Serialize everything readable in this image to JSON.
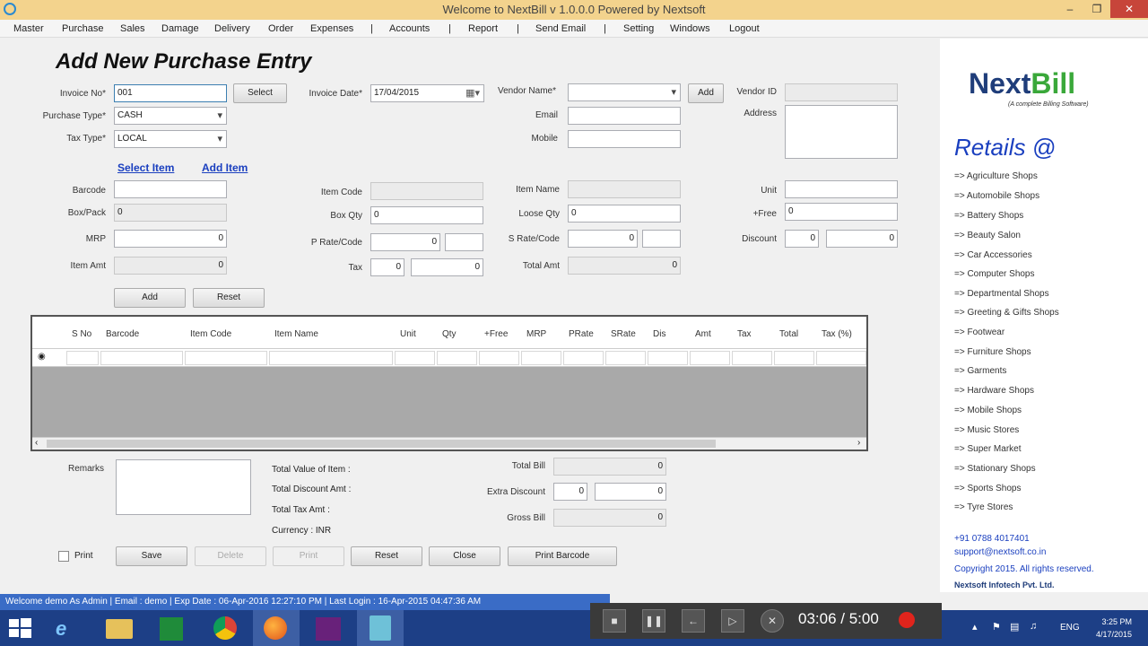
{
  "window": {
    "title": "Welcome to NextBill v 1.0.0.0 Powered by Nextsoft"
  },
  "menu": [
    "Master",
    "Purchase",
    "Sales",
    "Damage",
    "Delivery",
    "Order",
    "Expenses",
    "|",
    "Accounts",
    "|",
    "Report",
    "|",
    "Send Email",
    "|",
    "Setting",
    "Windows",
    "Logout"
  ],
  "page": {
    "title": "Add New Purchase Entry"
  },
  "form": {
    "invoice_no_label": "Invoice No*",
    "invoice_no": "001",
    "select_btn": "Select",
    "invoice_date_label": "Invoice Date*",
    "invoice_date": "17/04/2015",
    "vendor_name_label": "Vendor Name*",
    "add_btn": "Add",
    "vendor_id_label": "Vendor ID",
    "purchase_type_label": "Purchase Type*",
    "purchase_type": "CASH",
    "email_label": "Email",
    "address_label": "Address",
    "tax_type_label": "Tax Type*",
    "tax_type": "LOCAL",
    "mobile_label": "Mobile",
    "select_item_link": "Select Item",
    "add_item_link": "Add Item",
    "barcode_label": "Barcode",
    "item_code_label": "Item Code",
    "item_name_label": "Item Name",
    "unit_label": "Unit",
    "box_pack_label": "Box/Pack",
    "box_pack": "0",
    "box_qty_label": "Box Qty",
    "box_qty": "0",
    "loose_qty_label": "Loose Qty",
    "loose_qty": "0",
    "free_label": "+Free",
    "free": "0",
    "mrp_label": "MRP",
    "mrp": "0",
    "p_rate_label": "P Rate/Code",
    "p_rate": "0",
    "s_rate_label": "S Rate/Code",
    "s_rate": "0",
    "discount_label": "Discount",
    "discount_pct": "0",
    "discount_amt": "0",
    "item_amt_label": "Item Amt",
    "item_amt": "0",
    "tax_label": "Tax",
    "tax_pct": "0",
    "tax_amt": "0",
    "total_amt_label": "Total Amt",
    "total_amt": "0",
    "add_line_btn": "Add",
    "reset_line_btn": "Reset"
  },
  "grid": {
    "columns": [
      "S No",
      "Barcode",
      "Item Code",
      "Item Name",
      "Unit",
      "Qty",
      "+Free",
      "MRP",
      "PRate",
      "SRate",
      "Dis",
      "Amt",
      "Tax",
      "Total",
      "Tax (%)"
    ],
    "row_marker": "◉"
  },
  "footer": {
    "remarks_label": "Remarks",
    "total_value_label": "Total Value of Item :",
    "total_discount_label": "Total Discount Amt :",
    "total_tax_label": "Total Tax Amt :",
    "currency_label": "Currency : INR",
    "total_bill_label": "Total Bill",
    "total_bill": "0",
    "extra_discount_label": "Extra Discount",
    "extra_discount_pct": "0",
    "extra_discount_amt": "0",
    "gross_bill_label": "Gross Bill",
    "gross_bill": "0",
    "print_check_label": "Print",
    "save_btn": "Save",
    "delete_btn": "Delete",
    "print_btn": "Print",
    "reset_btn": "Reset",
    "close_btn": "Close",
    "print_barcode_btn": "Print Barcode"
  },
  "brand": {
    "logo_next": "Next",
    "logo_bill": "Bill",
    "tagline": "(A complete Billing Software)",
    "retails_title": "Retails @",
    "retails": [
      "=> Agriculture Shops",
      "=> Automobile Shops",
      "=> Battery Shops",
      "=> Beauty Salon",
      "=> Car Accessories",
      "=> Computer Shops",
      "=> Departmental Shops",
      "=> Greeting & Gifts Shops",
      "=> Footwear",
      "=> Furniture Shops",
      "=> Garments",
      "=> Hardware Shops",
      "=> Mobile Shops",
      "=> Music Stores",
      "=> Super Market",
      "=> Stationary Shops",
      "=> Sports Shops",
      "=> Tyre Stores"
    ],
    "phone": "+91 0788 4017401",
    "email": "support@nextsoft.co.in",
    "copyright": "Copyright 2015. All rights reserved.",
    "company": "Nextsoft Infotech Pvt. Ltd.",
    "colors": {
      "next": "#1f3d7a",
      "bill": "#3aa83a",
      "retails": "#1a3fbf"
    }
  },
  "status": {
    "text": "Welcome   demo  As  Admin   |   Email :  demo   |   Exp Date :  06-Apr-2016 12:27:10 PM   |   Last Login :  16-Apr-2015 04:47:36 AM"
  },
  "player": {
    "time": "03:06 / 5:00"
  },
  "taskbar": {
    "lang": "ENG",
    "clock_time": "3:25 PM",
    "clock_date": "4/17/2015"
  }
}
